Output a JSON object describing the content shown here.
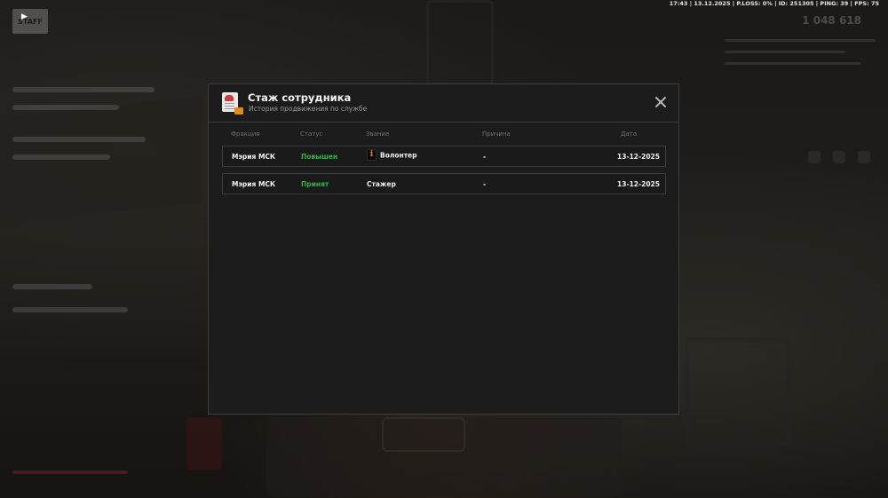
{
  "hud": {
    "stats": "17:43 | 13.12.2025 | P.LOSS: 0% | ID: 251305 | PING: 39 | FPS: 75",
    "money": "1 048 618"
  },
  "left_panel": {
    "logo": "STAFF"
  },
  "modal": {
    "title": "Стаж сотрудника",
    "subtitle": "История продвижения по службе",
    "columns": {
      "faction": "Фракция",
      "status": "Статус",
      "rank": "Звание",
      "reason": "Причина",
      "date": "Дата"
    },
    "rows": [
      {
        "faction": "Мэрия МСК",
        "status": "Повышен",
        "rank": "Волонтер",
        "rank_icon": "i",
        "reason": "-",
        "date": "13-12-2025"
      },
      {
        "faction": "Мэрия МСК",
        "status": "Принят",
        "rank": "Стажер",
        "reason": "-",
        "date": "13-12-2025"
      }
    ]
  },
  "colors": {
    "status_green": "#36b24a",
    "accent_orange": "#e08a1a"
  }
}
